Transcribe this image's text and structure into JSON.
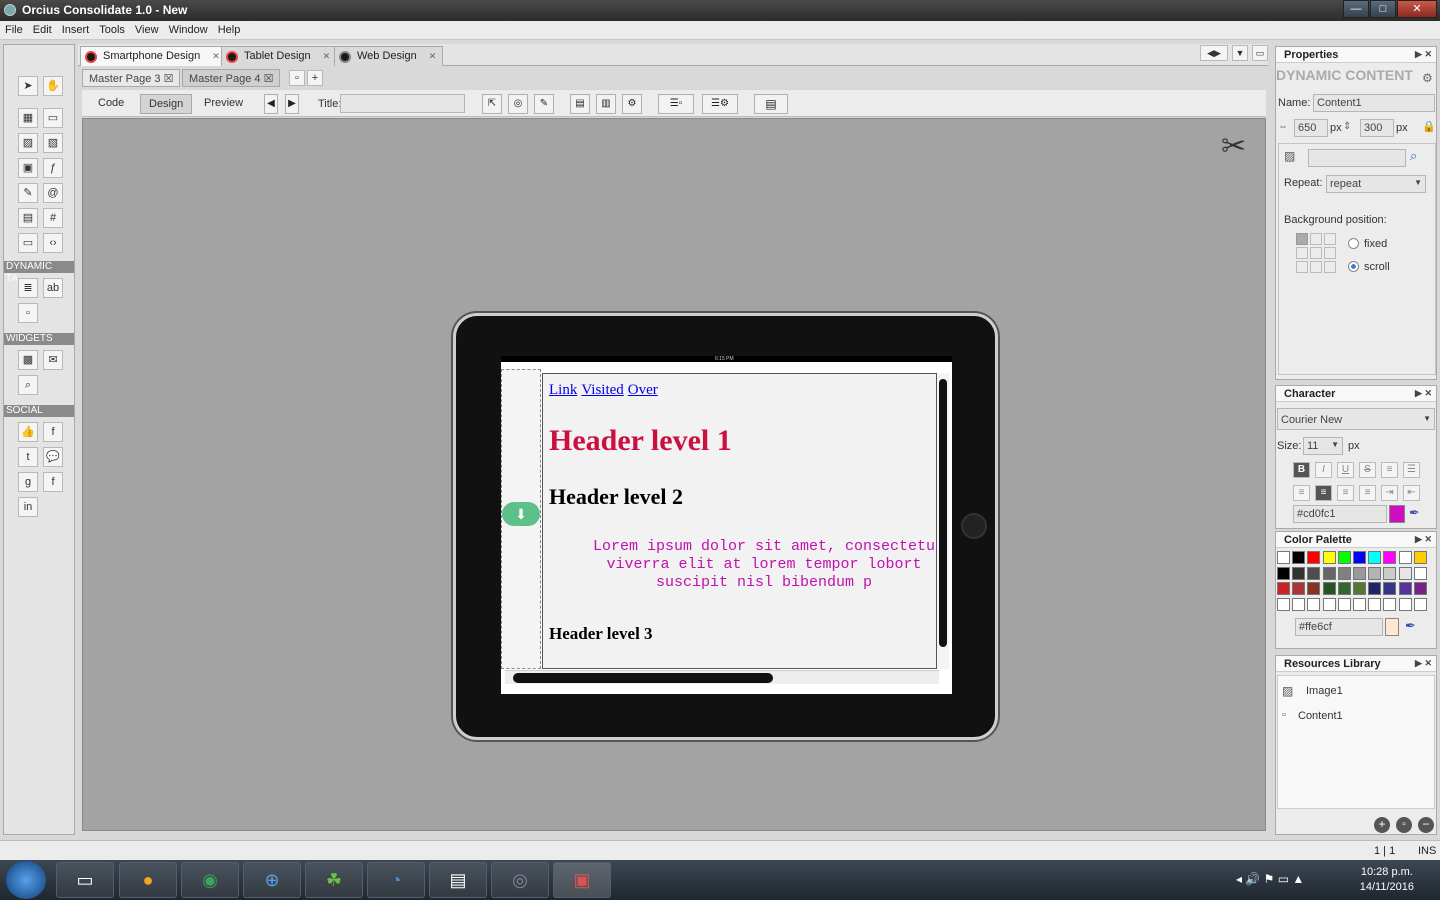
{
  "window": {
    "title": "Orcius Consolidate 1.0 - New",
    "controls": [
      "—",
      "□",
      "✕"
    ]
  },
  "menu": [
    "File",
    "Edit",
    "Insert",
    "Tools",
    "View",
    "Window",
    "Help"
  ],
  "toolbox": {
    "sections": [
      "DYNAMIC TA...",
      "WIDGETS",
      "SOCIAL"
    ]
  },
  "doc_tabs": [
    {
      "label": "Smartphone Design",
      "active": true
    },
    {
      "label": "Tablet Design",
      "active": false
    },
    {
      "label": "Web Design",
      "active": false
    }
  ],
  "page_tabs": [
    {
      "label": "Master Page 3",
      "active": false
    },
    {
      "label": "Master Page 4",
      "active": true
    }
  ],
  "view_modes": [
    "Code",
    "Design",
    "Preview"
  ],
  "active_view": "Design",
  "title_field": {
    "label": "Title:",
    "value": ""
  },
  "preview": {
    "status_time": "6:15 PM",
    "links": [
      "Link",
      "Visited",
      "Over"
    ],
    "h1": "Header level 1",
    "h2": "Header level 2",
    "lorem_lines": [
      "Lorem ipsum dolor sit amet, consectetu",
      "viverra elit at lorem tempor lobort",
      "suscipit nisl bibendum p"
    ],
    "h3": "Header level 3",
    "h1_color": "#cd0f3f",
    "lorem_color": "#c010b0"
  },
  "properties": {
    "title": "Properties",
    "section": "DYNAMIC CONTENT",
    "name_label": "Name:",
    "name_value": "Content1",
    "width_value": "650",
    "height_value": "300",
    "unit": "px",
    "repeat_label": "Repeat:",
    "repeat_value": "repeat",
    "bgpos_label": "Background position:",
    "fixed_label": "fixed",
    "scroll_label": "scroll",
    "attachment": "scroll"
  },
  "character": {
    "title": "Character",
    "font": "Courier New",
    "size_label": "Size:",
    "size_value": "11",
    "size_unit": "px",
    "color_value": "#cd0fc1",
    "color_swatch": "#cd0fc1"
  },
  "color_palette": {
    "title": "Color Palette",
    "row1": [
      "#ffffff",
      "#000000",
      "#ff0000",
      "#ffff00",
      "#00ff00",
      "#0000ff",
      "#00ffff",
      "#ff00ff",
      "#ffffff",
      "#ffcc00"
    ],
    "row2": [
      "#000000",
      "#333333",
      "#4d4d4d",
      "#666666",
      "#808080",
      "#999999",
      "#b3b3b3",
      "#cccccc",
      "#e6e6e6",
      "#ffffff"
    ],
    "row3": [
      "#cc2222",
      "#aa3333",
      "#883322",
      "#225522",
      "#336633",
      "#557733",
      "#222266",
      "#333388",
      "#553399",
      "#772288"
    ],
    "row4": [
      "#ffffff",
      "#ffffff",
      "#ffffff",
      "#ffffff",
      "#ffffff",
      "#ffffff",
      "#ffffff",
      "#ffffff",
      "#ffffff",
      "#ffffff"
    ],
    "selected_value": "#ffe6cf",
    "selected_swatch": "#ffe6cf"
  },
  "resources": {
    "title": "Resources Library",
    "items": [
      "Image1",
      "Content1"
    ]
  },
  "statusbar": {
    "position": "1 | 1",
    "mode": "INS"
  },
  "taskbar": {
    "time": "10:28 p.m.",
    "date": "14/11/2016"
  }
}
